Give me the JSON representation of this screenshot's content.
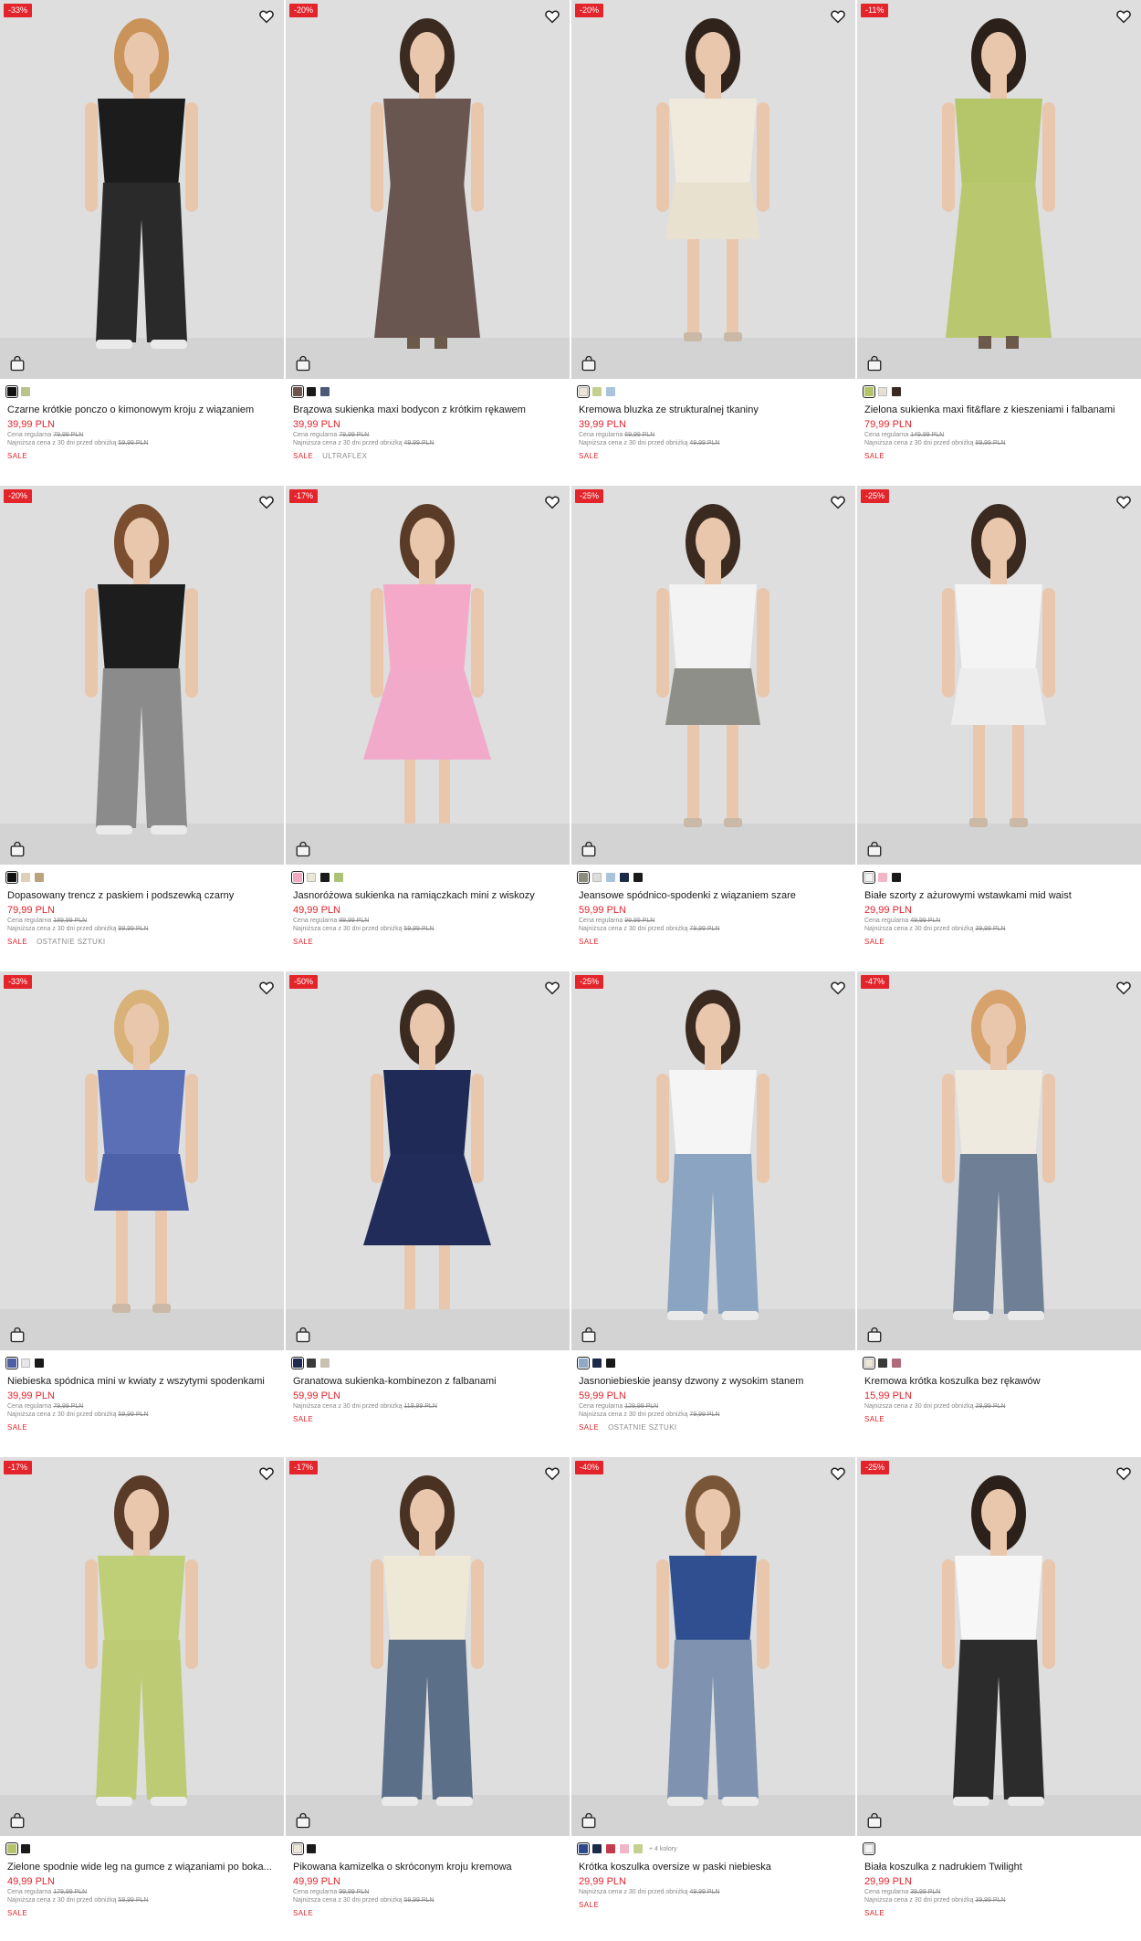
{
  "icons": {
    "heart": "heart-icon",
    "bag": "shopping-bag-icon"
  },
  "colors": {
    "sale_red": "#e3242b",
    "photo_bg": "#dedede"
  },
  "labels": {
    "regular_price": "Cena regularna",
    "lowest_price": "Najniższa cena z 30 dni przed obniżką"
  },
  "products": [
    {
      "discount": "-33%",
      "name": "Czarne krótkie ponczo o kimonowym kroju z wiązaniem",
      "price": "39,99 PLN",
      "regular": "79,99 PLN",
      "lowest": "59,99 PLN",
      "tags": [
        "SALE"
      ],
      "swatches": [
        "#111111",
        "#b9c48a"
      ],
      "outfit": {
        "top": "#1c1c1c",
        "bottom": "#2a2a2a",
        "hair": "#c9935a",
        "style": "pants"
      }
    },
    {
      "discount": "-20%",
      "name": "Brązowa sukienka maxi bodycon z krótkim rękawem",
      "price": "39,99 PLN",
      "regular": "79,99 PLN",
      "lowest": "49,99 PLN",
      "tags": [
        "SALE",
        "ULTRAFLEX"
      ],
      "swatches": [
        "#6b554d",
        "#1a1a1a",
        "#4c5a78"
      ],
      "outfit": {
        "top": "#6a5650",
        "bottom": "#6a5650",
        "hair": "#3a2a20",
        "style": "maxi"
      }
    },
    {
      "discount": "-20%",
      "name": "Kremowa bluzka ze strukturalnej tkaniny",
      "price": "39,99 PLN",
      "regular": "69,99 PLN",
      "lowest": "49,99 PLN",
      "tags": [
        "SALE"
      ],
      "swatches": [
        "#ece6d6",
        "#c4d18e",
        "#a9c3dc"
      ],
      "outfit": {
        "top": "#efeadc",
        "bottom": "#e8e1cf",
        "hair": "#2f231b",
        "style": "shorts"
      }
    },
    {
      "discount": "-11%",
      "name": "Zielona sukienka maxi fit&flare z kieszeniami i falbanami",
      "price": "79,99 PLN",
      "regular": "149,99 PLN",
      "lowest": "89,99 PLN",
      "tags": [
        "SALE"
      ],
      "swatches": [
        "#b3c46a",
        "#e7dfd0",
        "#3a2a20"
      ],
      "outfit": {
        "top": "#b5c56a",
        "bottom": "#b9c86f",
        "hair": "#2b211a",
        "style": "maxi"
      }
    },
    {
      "discount": "-20%",
      "name": "Dopasowany trencz z paskiem i podszewką czarny",
      "price": "79,99 PLN",
      "regular": "189,99 PLN",
      "lowest": "99,99 PLN",
      "tags": [
        "SALE",
        "OSTATNIE SZTUKI"
      ],
      "swatches": [
        "#111111",
        "#ddd2b9",
        "#b9a47c"
      ],
      "outfit": {
        "top": "#1d1d1d",
        "bottom": "#8b8b8b",
        "hair": "#7a4e2e",
        "style": "pants"
      }
    },
    {
      "discount": "-17%",
      "name": "Jasnoróżowa sukienka na ramiączkach mini z wiskozy",
      "price": "49,99 PLN",
      "regular": "89,99 PLN",
      "lowest": "59,99 PLN",
      "tags": [
        "SALE"
      ],
      "swatches": [
        "#f3a9c2",
        "#ece6d6",
        "#1a1a1a",
        "#aec276"
      ],
      "outfit": {
        "top": "#f4a9c8",
        "bottom": "#f2aaca",
        "hair": "#5a3b28",
        "style": "dress"
      }
    },
    {
      "discount": "-25%",
      "name": "Jeansowe spódnico-spodenki z wiązaniem szare",
      "price": "59,99 PLN",
      "regular": "99,99 PLN",
      "lowest": "79,99 PLN",
      "tags": [
        "SALE"
      ],
      "swatches": [
        "#8c8c7e",
        "#dedede",
        "#a9c3dc",
        "#1c2a4a",
        "#1a1a1a"
      ],
      "outfit": {
        "top": "#f3f3f3",
        "bottom": "#8f8f89",
        "hair": "#3a2a20",
        "style": "shorts"
      }
    },
    {
      "discount": "-25%",
      "name": "Białe szorty z ażurowymi wstawkami mid waist",
      "price": "29,99 PLN",
      "regular": "49,99 PLN",
      "lowest": "39,99 PLN",
      "tags": [
        "SALE"
      ],
      "swatches": [
        "#f3f3f3",
        "#f3b6c6",
        "#1a1a1a"
      ],
      "outfit": {
        "top": "#f4f4f4",
        "bottom": "#ededed",
        "hair": "#3a2a20",
        "style": "shorts"
      }
    },
    {
      "discount": "-33%",
      "name": "Niebieska spódnica mini w kwiaty z wszytymi spodenkami",
      "price": "39,99 PLN",
      "regular": "79,99 PLN",
      "lowest": "59,99 PLN",
      "tags": [
        "SALE"
      ],
      "swatches": [
        "#4a5fa6",
        "#e8e8e8",
        "#1a1a1a"
      ],
      "outfit": {
        "top": "#5a6fb6",
        "bottom": "#4d62a8",
        "hair": "#d9b27a",
        "style": "skirt"
      }
    },
    {
      "discount": "-50%",
      "name": "Granatowa sukienka-kombinezon z falbanami",
      "price": "59,99 PLN",
      "regular": "",
      "lowest": "119,99 PLN",
      "tags": [
        "SALE"
      ],
      "swatches": [
        "#1f2a4e",
        "#3a3a3a",
        "#c9c0b0"
      ],
      "outfit": {
        "top": "#1f2a56",
        "bottom": "#222c5a",
        "hair": "#3a2a20",
        "style": "dress"
      }
    },
    {
      "discount": "-25%",
      "name": "Jasnoniebieskie jeansy dzwony z wysokim stanem",
      "price": "59,99 PLN",
      "regular": "129,99 PLN",
      "lowest": "79,99 PLN",
      "tags": [
        "SALE",
        "OSTATNIE SZTUKI"
      ],
      "swatches": [
        "#8fa9c6",
        "#1c2a4a",
        "#1a1a1a"
      ],
      "outfit": {
        "top": "#f5f5f5",
        "bottom": "#8aa4c2",
        "hair": "#3a2a20",
        "style": "pants"
      }
    },
    {
      "discount": "-47%",
      "name": "Kremowa krótka koszulka bez rękawów",
      "price": "15,99 PLN",
      "regular": "",
      "lowest": "29,99 PLN",
      "tags": [
        "SALE"
      ],
      "swatches": [
        "#ece6d6",
        "#3a3a3a",
        "#b06a7a"
      ],
      "outfit": {
        "top": "#eeeae0",
        "bottom": "#6e7f96",
        "hair": "#d7a26b",
        "style": "pants"
      }
    },
    {
      "discount": "-17%",
      "name": "Zielone spodnie wide leg na gumce z wiązaniami po boka...",
      "price": "49,99 PLN",
      "regular": "179,99 PLN",
      "lowest": "59,99 PLN",
      "tags": [
        "SALE"
      ],
      "swatches": [
        "#b3c46a",
        "#1a1a1a"
      ],
      "outfit": {
        "top": "#bfcf78",
        "bottom": "#bccb74",
        "hair": "#5a3b28",
        "style": "pants"
      }
    },
    {
      "discount": "-17%",
      "name": "Pikowana kamizelka o skróconym kroju kremowa",
      "price": "49,99 PLN",
      "regular": "99,99 PLN",
      "lowest": "59,99 PLN",
      "tags": [
        "SALE"
      ],
      "swatches": [
        "#ece6d6",
        "#1a1a1a"
      ],
      "outfit": {
        "top": "#eee8d6",
        "bottom": "#5c6f88",
        "hair": "#4a3223",
        "style": "pants"
      }
    },
    {
      "discount": "-40%",
      "name": "Krótka koszulka oversize w paski niebieska",
      "price": "29,99 PLN",
      "regular": "",
      "lowest": "49,99 PLN",
      "tags": [
        "SALE"
      ],
      "swatches": [
        "#2f4a8a",
        "#1c2a4a",
        "#c53a4c",
        "#f3b6c6",
        "#c4d18e"
      ],
      "more": "+ 4 kolory",
      "outfit": {
        "top": "#2f4f90",
        "bottom": "#7f93b0",
        "hair": "#7a5638",
        "style": "pants"
      }
    },
    {
      "discount": "-25%",
      "name": "Biała koszulka z nadrukiem Twilight",
      "price": "29,99 PLN",
      "regular": "39,99 PLN",
      "lowest": "39,99 PLN",
      "tags": [
        "SALE"
      ],
      "swatches": [
        "#f3f3f3"
      ],
      "outfit": {
        "top": "#f7f7f7",
        "bottom": "#2c2c2c",
        "hair": "#2b211a",
        "style": "pants"
      }
    }
  ]
}
